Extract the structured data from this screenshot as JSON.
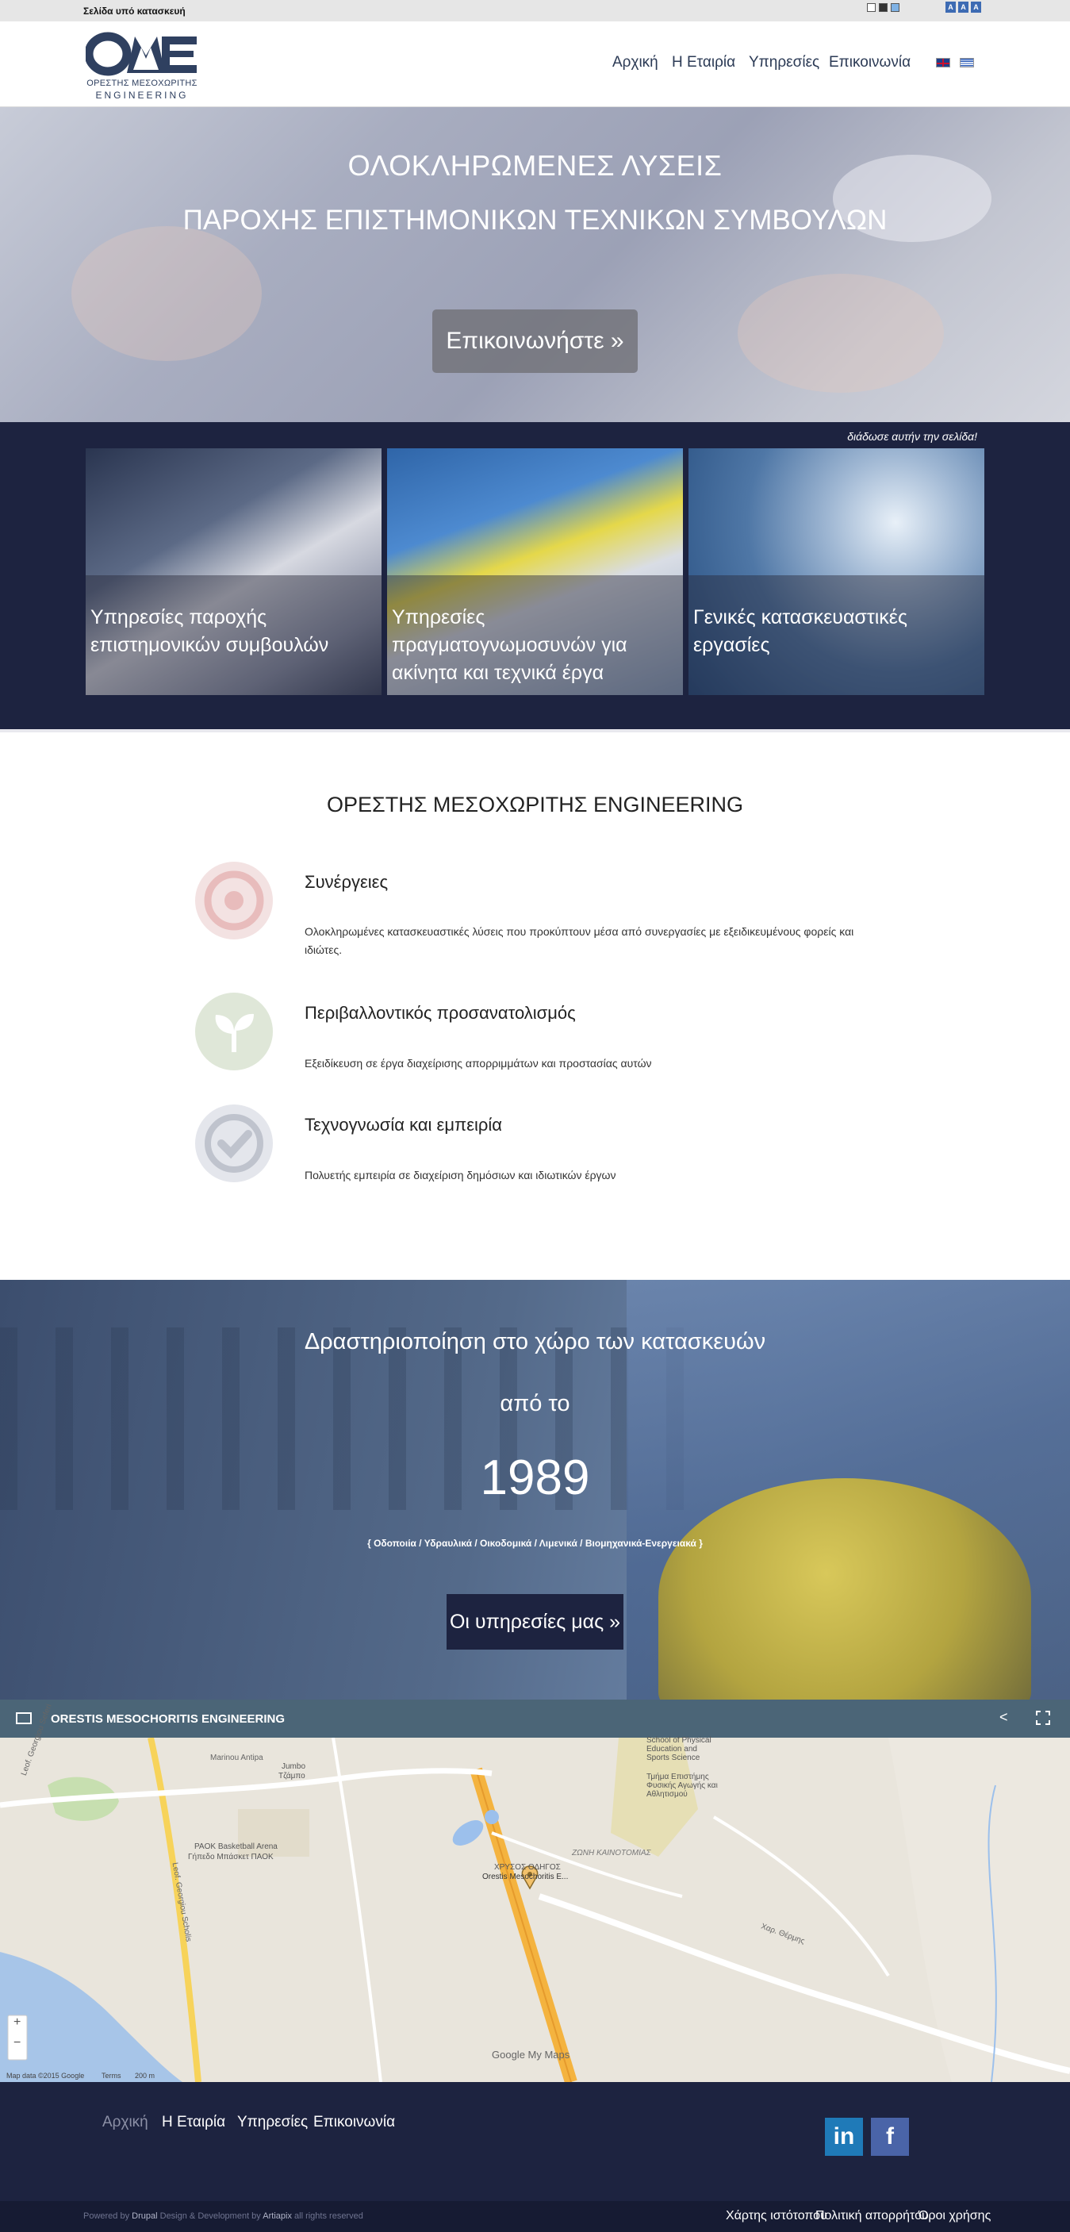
{
  "topbar": {
    "notice": "Σελίδα υπό κατασκευή"
  },
  "brand": {
    "name": "ΟΡΕΣΤΗΣ ΜΕΣΟΧΩΡΙΤΗΣ",
    "sub": "ENGINEERING"
  },
  "nav": [
    {
      "label": "Αρχική"
    },
    {
      "label": "Η Εταιρία"
    },
    {
      "label": "Υπηρεσίες"
    },
    {
      "label": "Επικοινωνία"
    }
  ],
  "hero": {
    "line1": "ΟΛΟΚΛΗΡΩΜΕΝΕΣ ΛΥΣΕΙΣ",
    "line2": "ΠΑΡΟΧΗΣ ΕΠΙΣΤΗΜΟΝΙΚΩΝ ΤΕΧΝΙΚΩΝ ΣΥΜΒΟΥΛΩΝ",
    "button": "Επικοινωνήστε »"
  },
  "services": {
    "share": "διάδωσε αυτήν την σελίδα!",
    "cards": [
      {
        "title": "Υπηρεσίες παροχής επιστημονικών συμβουλών"
      },
      {
        "title": "Υπηρεσίες πραγματογνωμοσυνών για ακίνητα και τεχνικά έργα"
      },
      {
        "title": "Γενικές κατασκευαστικές εργασίες"
      }
    ]
  },
  "about": {
    "heading": "ΟΡΕΣΤΗΣ ΜΕΣΟΧΩΡΙΤΗΣ ENGINEERING",
    "features": [
      {
        "title": "Συνέργειες",
        "text": "Ολοκληρωμένες κατασκευαστικές λύσεις που προκύπτουν μέσα από συνεργασίες με εξειδικευμένους φορείς και ιδιώτες.",
        "color": "#f0d4d4",
        "accent": "#e8b8b8"
      },
      {
        "title": "Περιβαλλοντικός προσανατολισμός",
        "text": "Εξειδίκευση σε έργα διαχείρισης απορριμμάτων και προστασίας αυτών",
        "color": "#dfe7d8",
        "accent": "#ffffff"
      },
      {
        "title": "Τεχνογνωσία και εμπειρία",
        "text": "Πολυετής εμπειρία σε διαχείριση δημόσιων και ιδιωτικών έργων",
        "color": "#e1e3ea",
        "accent": "#b9bdc8"
      }
    ]
  },
  "since": {
    "line1": "Δραστηριοποίηση στο χώρο των κατασκευών",
    "line2": "από το",
    "year": "1989",
    "areas": "{ Οδοποιία / Υδραυλικά / Οικοδομικά / Λιμενικά / Βιομηχανικά-Ενεργειακά }",
    "button": "Οι υπηρεσίες μας »"
  },
  "map": {
    "title": "ORESTIS MESOCHORITIS ENGINEERING",
    "labels": {
      "school": "School of Physical Education and Sports Science",
      "school_gr": "Τμήμα Επιστήμης Φυσικής Αγωγής και Αθλητισμού",
      "arena": "PAOK Basketball Arena",
      "arena_gr": "Γήπεδο Μπάσκετ ΠΑΟΚ",
      "jumbo": "Jumbo",
      "jumbo_gr": "Τζάμπο",
      "zone": "ΖΩΝΗ ΚΑΙΝΟΤΟΜΙΑΣ",
      "pin_gr": "ΧΡΥΣΟΣ ΟΔΗΓΟΣ",
      "pin": "Orestis Mesochoritis E...",
      "road1": "Marinou Antipa",
      "road2": "Leof. Georgiou Seferi",
      "road3": "Leof. Georgiou Scholis",
      "road4": "Χαρ. Θέρμης",
      "google": "Google My Maps",
      "credits": "Map data ©2015 Google",
      "terms": "Terms",
      "scale": "200 m",
      "zoom_in": "+",
      "zoom_out": "−"
    }
  },
  "footer": {
    "nav": [
      {
        "label": "Αρχική"
      },
      {
        "label": "Η Εταιρία"
      },
      {
        "label": "Υπηρεσίες"
      },
      {
        "label": "Επικοινωνία"
      }
    ],
    "social": {
      "linkedin": "in",
      "facebook": "f"
    },
    "powered": "Powered by",
    "drupal": "Drupal",
    "design": "Design & Development by",
    "artiapix": "Artiapix",
    "rights": "all rights reserved",
    "links": [
      {
        "label": "Χάρτης ιστότοπου"
      },
      {
        "label": "Πολιτική απορρήτου"
      },
      {
        "label": "Όροι χρήσης"
      }
    ]
  },
  "colors": {
    "navy": "#1d2340",
    "accent": "#2f4060",
    "map_bar": "#4b6577"
  }
}
